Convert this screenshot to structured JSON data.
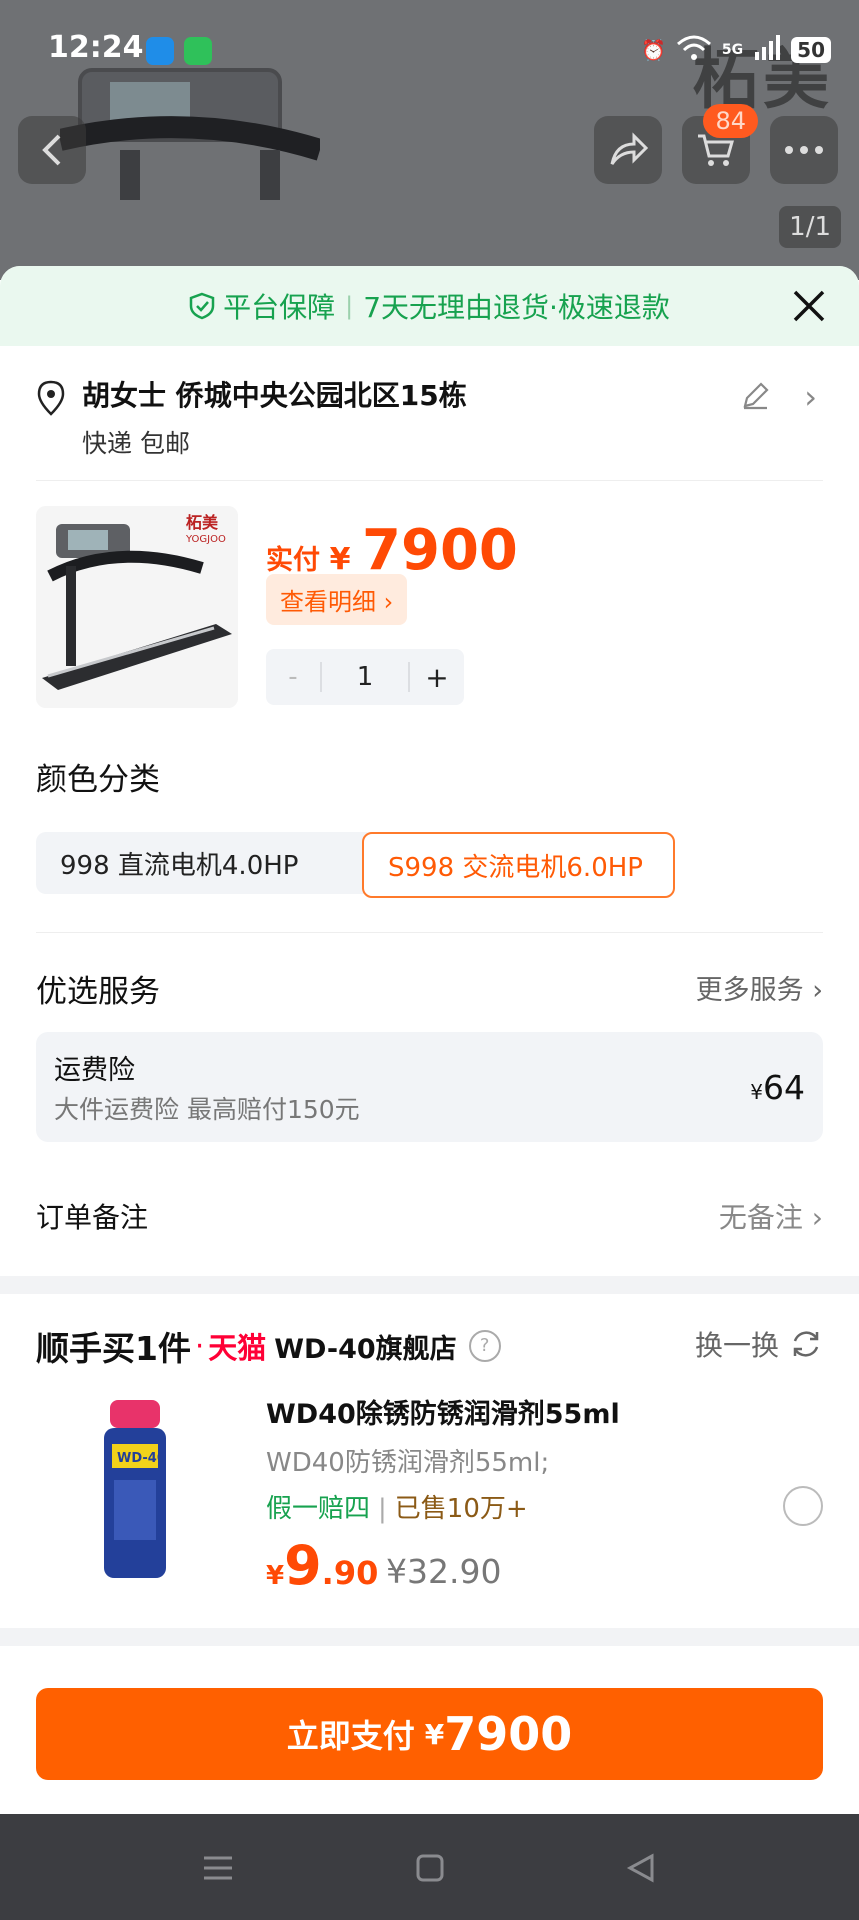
{
  "status_bar": {
    "time": "12:24",
    "network": "5G",
    "battery": "50"
  },
  "header": {
    "cart_count": "84",
    "image_pager": "1/1",
    "brand_watermark": "柘美"
  },
  "guarantee": {
    "label": "平台保障",
    "detail": "7天无理由退货·极速退款"
  },
  "address": {
    "name_line": "胡女士 侨城中央公园北区15栋",
    "shipping": "快递 包邮"
  },
  "product": {
    "price_prefix": "实付",
    "currency": "¥",
    "price": "7900",
    "detail_button": "查看明细 ›",
    "quantity": "1",
    "minus": "-",
    "plus": "+"
  },
  "variants": {
    "title": "颜色分类",
    "options": [
      {
        "label": "998 直流电机4.0HP",
        "selected": false
      },
      {
        "label": "S998 交流电机6.0HP",
        "selected": true
      }
    ]
  },
  "services": {
    "title": "优选服务",
    "more": "更多服务 ›",
    "item": {
      "name": "运费险",
      "desc": "大件运费险 最高赔付150元",
      "currency": "¥",
      "price": "64"
    }
  },
  "note": {
    "label": "订单备注",
    "value": "无备注 ›"
  },
  "addon": {
    "title": "顺手买1件",
    "dot": "·",
    "platform": "天猫",
    "store": "WD-40旗舰店",
    "help": "?",
    "swap": "换一换",
    "item": {
      "title": "WD40除锈防锈润滑剂55ml",
      "subtitle": "WD40防锈润滑剂55ml;",
      "tag_guarantee": "假一赔四",
      "tag_sep": "|",
      "tag_sold": "已售10万+",
      "currency": "¥",
      "price_int": "9",
      "price_dec": ".90",
      "original_price": "¥32.90"
    }
  },
  "pay": {
    "label": "立即支付",
    "currency": "¥",
    "amount": "7900"
  },
  "colors": {
    "accent": "#ff6000",
    "price": "#ff4a05",
    "green": "#17a24f"
  }
}
